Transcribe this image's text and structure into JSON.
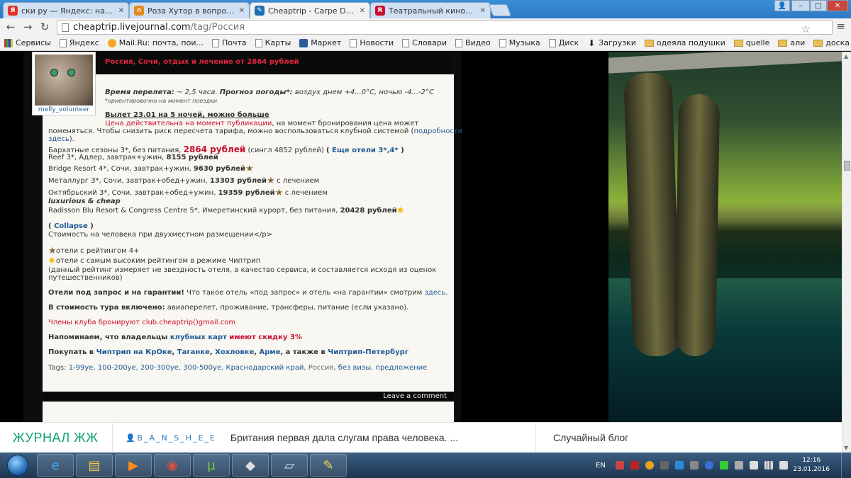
{
  "tabs": [
    {
      "title": "ски ру — Яндекс: нашлось",
      "favicon_text": "Я",
      "favicon_color": "#e5332a"
    },
    {
      "title": "Роза Хутор в вопросах и",
      "favicon_text": "∩",
      "favicon_color": "#e08a1c"
    },
    {
      "title": "Cheaptrip - Carpe Diem - ",
      "favicon_text": "✎",
      "favicon_color": "#1f6fb5"
    },
    {
      "title": "Театральный киносезон",
      "favicon_text": "R",
      "favicon_color": "#c8102e"
    }
  ],
  "window_controls": {
    "user": "👤",
    "minimize": "–",
    "maximize": "□",
    "close": "✕"
  },
  "toolbar": {
    "back": "←",
    "forward": "→",
    "reload": "↻",
    "url_host": "cheaptrip.livejournal.com",
    "url_path": "/tag/Россия",
    "star": "☆",
    "menu": "≡"
  },
  "bookmarks": [
    {
      "label": "Сервисы",
      "icon": "apps-icon"
    },
    {
      "label": "Яндекс",
      "icon": "page-icon"
    },
    {
      "label": "Mail.Ru: почта, пои...",
      "icon": "mail-icon"
    },
    {
      "label": "Почта",
      "icon": "page-icon"
    },
    {
      "label": "Карты",
      "icon": "page-icon"
    },
    {
      "label": "Маркет",
      "icon": "market-icon"
    },
    {
      "label": "Новости",
      "icon": "page-icon"
    },
    {
      "label": "Словари",
      "icon": "page-icon"
    },
    {
      "label": "Видео",
      "icon": "page-icon"
    },
    {
      "label": "Музыка",
      "icon": "page-icon"
    },
    {
      "label": "Диск",
      "icon": "page-icon"
    },
    {
      "label": "Загрузки",
      "icon": "download-icon"
    },
    {
      "label": "одеяла подушки",
      "icon": "folder-icon"
    },
    {
      "label": "quelle",
      "icon": "folder-icon"
    },
    {
      "label": "али",
      "icon": "folder-icon"
    },
    {
      "label": "доска",
      "icon": "folder-icon"
    }
  ],
  "post": {
    "title": "Россия, Сочи, отдых и лечение от 2864 рублей",
    "avatar_name": "melly_volunteer",
    "flight_label": "Время перелета:",
    "flight_value": " ~ 2,5 часа. ",
    "weather_label": "Прогноз погоды*:",
    "weather_value": " воздух днем +4...0°C, ночью -4...-2°C",
    "weather_note": "*ориентировочно на момент поездки",
    "departure": "Вылет 23.01 на 5 ночей, можно больше",
    "price_note_red": "Цена действительна на момент публикации",
    "price_note_rest": ", на момент бронирования цена может",
    "price_note_line2": "поменяться. Чтобы снизить риск пересчета тарифа, можно воспользоваться клубной системой (",
    "price_note_link": "подробности",
    "price_note_link2": "здесь",
    "price_note_end": ").",
    "hotel1_name": "Бархатные сезоны 3*, без питания, ",
    "hotel1_price": "2864 рублей",
    "hotel1_single": " (сингл 4852 рублей) ",
    "more_hotels_open": "( ",
    "more_hotels_link": "Еще отели 3*,4*",
    "more_hotels_close": " )",
    "hotel2_name": "Reef 3*, Адлер, завтрак+ужин, ",
    "hotel2_price": "8155 рублей",
    "hotel3_name": "Bridge Resort 4*, Сочи, завтрак+ужин, ",
    "hotel3_price": "9630 рублей",
    "hotel4_name": "Металлург 3*, Сочи, завтрак+обед+ужин, ",
    "hotel4_price": "13303 рублей",
    "hotel4_tail": " с лечением",
    "hotel5_name": "Октябрьский 3*, Сочи, завтрак+обед+ужин, ",
    "hotel5_price": "19359 рублей",
    "hotel5_tail": " с лечением",
    "lux_heading": "luxurious & cheap",
    "hotel6_name": "Radisson Blu Resort & Congress Centre 5*, Имеретинский курорт, без питания, ",
    "hotel6_price": "20428 рублей",
    "collapse_open": "( ",
    "collapse_link": "Collapse",
    "collapse_close": " )",
    "per_person": "Стоимость на человека при двухместном размещении</p>",
    "legend1": "отели с рейтингом 4+",
    "legend2": "отели с самым высоким рейтингом в режиме Чиптрип",
    "legend3": "(данный рейтинг измеряет не звездность отеля, а качество сервиса, и составляется исходя из оценок",
    "legend4": "путешественников)",
    "guarantee_bold": "Отели под запрос и на гарантии!",
    "guarantee_text": " Что такое отель «под запрос» и отель «на гарантии» смотрим ",
    "guarantee_link": "здесь",
    "guarantee_end": ".",
    "included_bold": "В стоимость тура включено:",
    "included_text": " авиаперелет, проживание, трансферы, питание (если указано).",
    "club_email": "Члены клуба бронируют club.cheaptrip()gmail.com",
    "reminder_a": "Напоминаем, что владельцы ",
    "reminder_link": "клубных карт",
    "reminder_b": " имеют скидку 3%",
    "buy_a": "Покупать в ",
    "buy_link1": "Чиптрип на КрОке",
    "buy_sep1": ", ",
    "buy_link2": "Таганке",
    "buy_sep2": ", ",
    "buy_link3": "Хохловке",
    "buy_sep3": ", ",
    "buy_link4": "Арме",
    "buy_b": ", а также в ",
    "buy_link5": "Чиптрип-Петербург",
    "tags_label": "Tags: ",
    "tags": [
      "1-99уе",
      "100-200уе",
      "200-300уе",
      "300-500уе",
      "Краснодарский край",
      "Россия",
      "без визы",
      "предложение"
    ],
    "leave_comment": "Leave a comment"
  },
  "ljbar": {
    "logo": "ЖУРНАЛ ЖЖ",
    "user": "B_A_N_S_H_E_E",
    "news": "Британия первая дала слугам права человека. ...",
    "random": "Случайный блог"
  },
  "taskbar": {
    "apps": [
      "ie-icon",
      "explorer-icon",
      "media-icon",
      "chrome-icon",
      "utorrent-icon",
      "app-icon",
      "notepad-icon",
      "paint-icon"
    ],
    "lang": "EN",
    "time": "12:16",
    "date": "23.01.2016"
  },
  "colors": {
    "accent_red": "#c8102e",
    "link_blue": "#1f5a99",
    "lj_green": "#0fa36b"
  }
}
